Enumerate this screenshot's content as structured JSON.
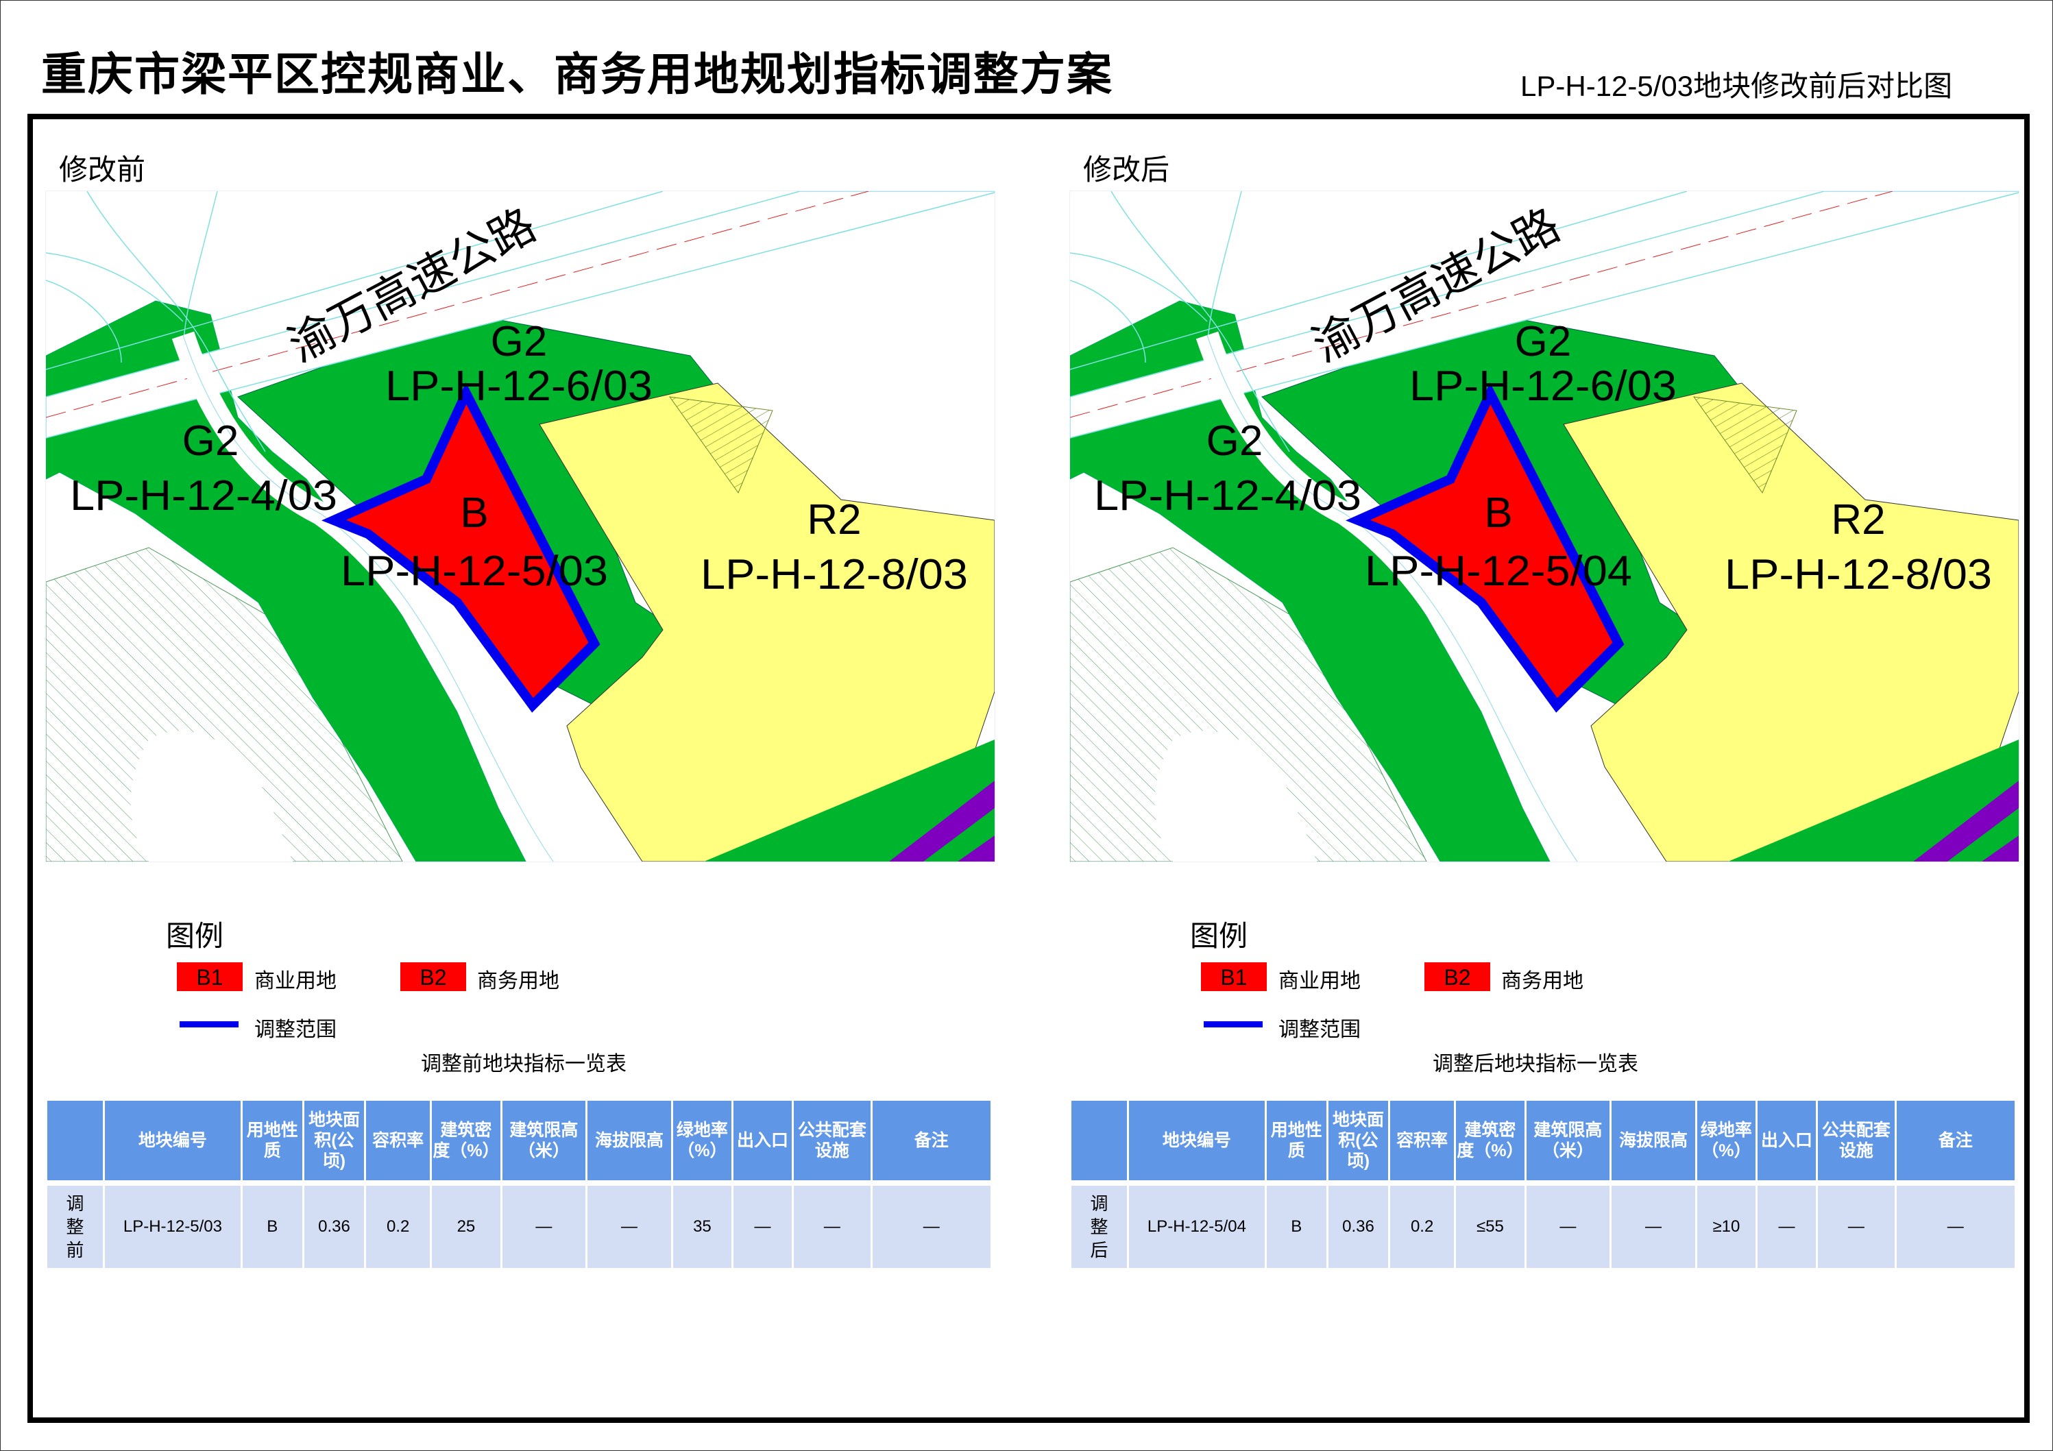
{
  "header": {
    "title": "重庆市梁平区控规商业、商务用地规划指标调整方案",
    "subtitle": "LP-H-12-5/03地块修改前后对比图"
  },
  "colors": {
    "green_space": "#00b52e",
    "residential": "#ffff80",
    "commercial": "#ff0000",
    "adjust_boundary": "#0000ee",
    "purple_strip": "#8000c0",
    "table_header": "#5f96e5",
    "table_row": "#d3def4"
  },
  "panels": [
    {
      "label": "修改前",
      "map": {
        "road_label": "渝万高速公路",
        "parcels": [
          {
            "code": "G2",
            "id": "LP-H-12-6/03"
          },
          {
            "code": "G2",
            "id": "LP-H-12-4/03"
          },
          {
            "code": "B",
            "id": "LP-H-12-5/03"
          },
          {
            "code": "R2",
            "id": "LP-H-12-8/03"
          }
        ]
      },
      "legend": {
        "title": "图例",
        "items": [
          {
            "swatch": "B1",
            "label": "商业用地"
          },
          {
            "swatch": "B2",
            "label": "商务用地"
          },
          {
            "swatch": "line",
            "label": "调整范围"
          }
        ]
      },
      "table": {
        "caption": "调整前地块指标一览表",
        "headers": [
          "",
          "地块编号",
          "用地性质",
          "地块面积(公顷)",
          "容积率",
          "建筑密度（%）",
          "建筑限高（米）",
          "海拔限高",
          "绿地率（%）",
          "出入口",
          "公共配套设施",
          "备注"
        ],
        "rows": [
          [
            "调整前",
            "LP-H-12-5/03",
            "B",
            "0.36",
            "0.2",
            "25",
            "—",
            "—",
            "35",
            "—",
            "—",
            "—"
          ]
        ]
      }
    },
    {
      "label": "修改后",
      "map": {
        "road_label": "渝万高速公路",
        "parcels": [
          {
            "code": "G2",
            "id": "LP-H-12-6/03"
          },
          {
            "code": "G2",
            "id": "LP-H-12-4/03"
          },
          {
            "code": "B",
            "id": "LP-H-12-5/04"
          },
          {
            "code": "R2",
            "id": "LP-H-12-8/03"
          }
        ]
      },
      "legend": {
        "title": "图例",
        "items": [
          {
            "swatch": "B1",
            "label": "商业用地"
          },
          {
            "swatch": "B2",
            "label": "商务用地"
          },
          {
            "swatch": "line",
            "label": "调整范围"
          }
        ]
      },
      "table": {
        "caption": "调整后地块指标一览表",
        "headers": [
          "",
          "地块编号",
          "用地性质",
          "地块面积(公顷)",
          "容积率",
          "建筑密度（%）",
          "建筑限高（米）",
          "海拔限高",
          "绿地率（%）",
          "出入口",
          "公共配套设施",
          "备注"
        ],
        "rows": [
          [
            "调整后",
            "LP-H-12-5/04",
            "B",
            "0.36",
            "0.2",
            "≤55",
            "—",
            "—",
            "≥10",
            "—",
            "—",
            "—"
          ]
        ]
      }
    }
  ]
}
